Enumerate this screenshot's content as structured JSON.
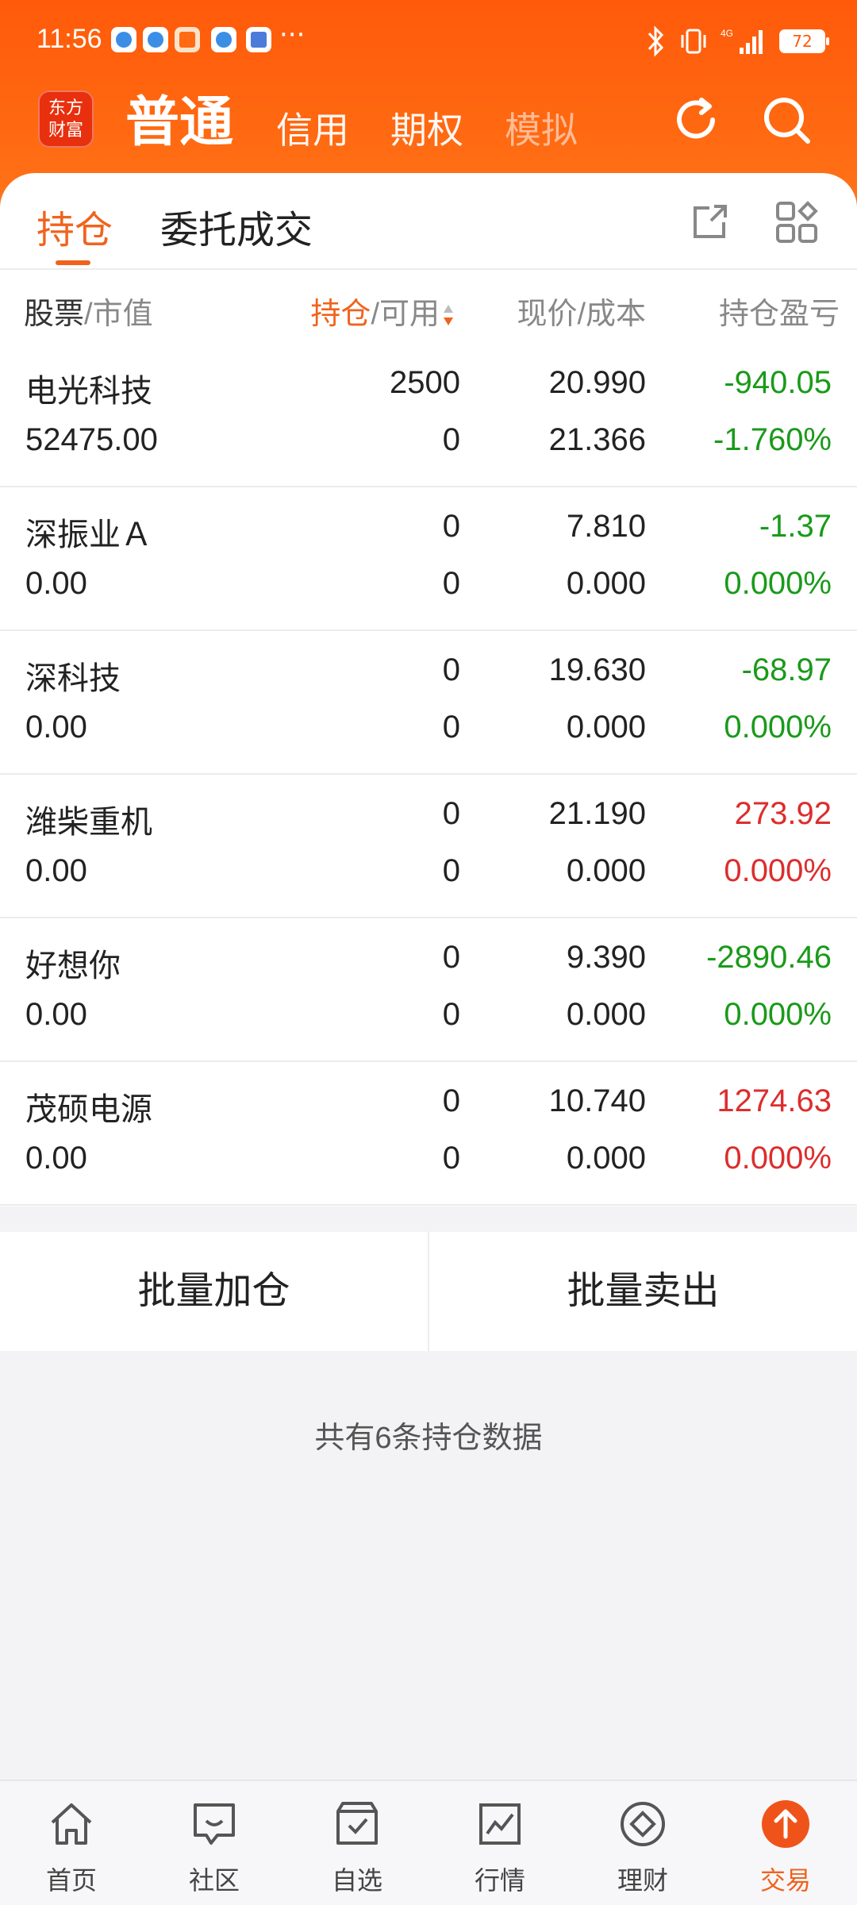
{
  "status": {
    "time": "11:56",
    "battery": "72",
    "more": "···"
  },
  "logo": {
    "line1": "东方",
    "line2": "财富"
  },
  "account_tabs": [
    "普通",
    "信用",
    "期权",
    "模拟"
  ],
  "sub_tabs": {
    "active": "持仓",
    "other": "委托成交"
  },
  "columns": {
    "col1_main": "股票",
    "col1_sub": "/市值",
    "col2_main": "持仓",
    "col2_sub": "/可用",
    "col3": "现价/成本",
    "col4": "持仓盈亏"
  },
  "rows": [
    {
      "name": "电光科技",
      "market_value": "52475.00",
      "position": "2500",
      "available": "0",
      "price": "20.990",
      "cost": "21.366",
      "pnl": "-940.05",
      "pnl_pct": "-1.760%",
      "pnl_color": "#1a9a1a",
      "pct_color": "#1a9a1a"
    },
    {
      "name": "深振业Ａ",
      "market_value": "0.00",
      "position": "0",
      "available": "0",
      "price": "7.810",
      "cost": "0.000",
      "pnl": "-1.37",
      "pnl_pct": "0.000%",
      "pnl_color": "#1a9a1a",
      "pct_color": "#1a9a1a"
    },
    {
      "name": "深科技",
      "market_value": "0.00",
      "position": "0",
      "available": "0",
      "price": "19.630",
      "cost": "0.000",
      "pnl": "-68.97",
      "pnl_pct": "0.000%",
      "pnl_color": "#1a9a1a",
      "pct_color": "#1a9a1a"
    },
    {
      "name": "潍柴重机",
      "market_value": "0.00",
      "position": "0",
      "available": "0",
      "price": "21.190",
      "cost": "0.000",
      "pnl": "273.92",
      "pnl_pct": "0.000%",
      "pnl_color": "#dd2d2d",
      "pct_color": "#dd2d2d"
    },
    {
      "name": "好想你",
      "market_value": "0.00",
      "position": "0",
      "available": "0",
      "price": "9.390",
      "cost": "0.000",
      "pnl": "-2890.46",
      "pnl_pct": "0.000%",
      "pnl_color": "#1a9a1a",
      "pct_color": "#1a9a1a"
    },
    {
      "name": "茂硕电源",
      "market_value": "0.00",
      "position": "0",
      "available": "0",
      "price": "10.740",
      "cost": "0.000",
      "pnl": "1274.63",
      "pnl_pct": "0.000%",
      "pnl_color": "#dd2d2d",
      "pct_color": "#dd2d2d"
    }
  ],
  "batch": {
    "add": "批量加仓",
    "sell": "批量卖出"
  },
  "summary": "共有6条持仓数据",
  "nav": [
    {
      "label": "首页",
      "icon": "home-icon"
    },
    {
      "label": "社区",
      "icon": "community-icon"
    },
    {
      "label": "自选",
      "icon": "watchlist-icon"
    },
    {
      "label": "行情",
      "icon": "market-icon"
    },
    {
      "label": "理财",
      "icon": "wealth-icon"
    },
    {
      "label": "交易",
      "icon": "trade-icon"
    }
  ],
  "colors": {
    "brand": "#ff5a0a",
    "accent": "#f0631d",
    "down": "#1a9a1a",
    "up": "#dd2d2d"
  }
}
